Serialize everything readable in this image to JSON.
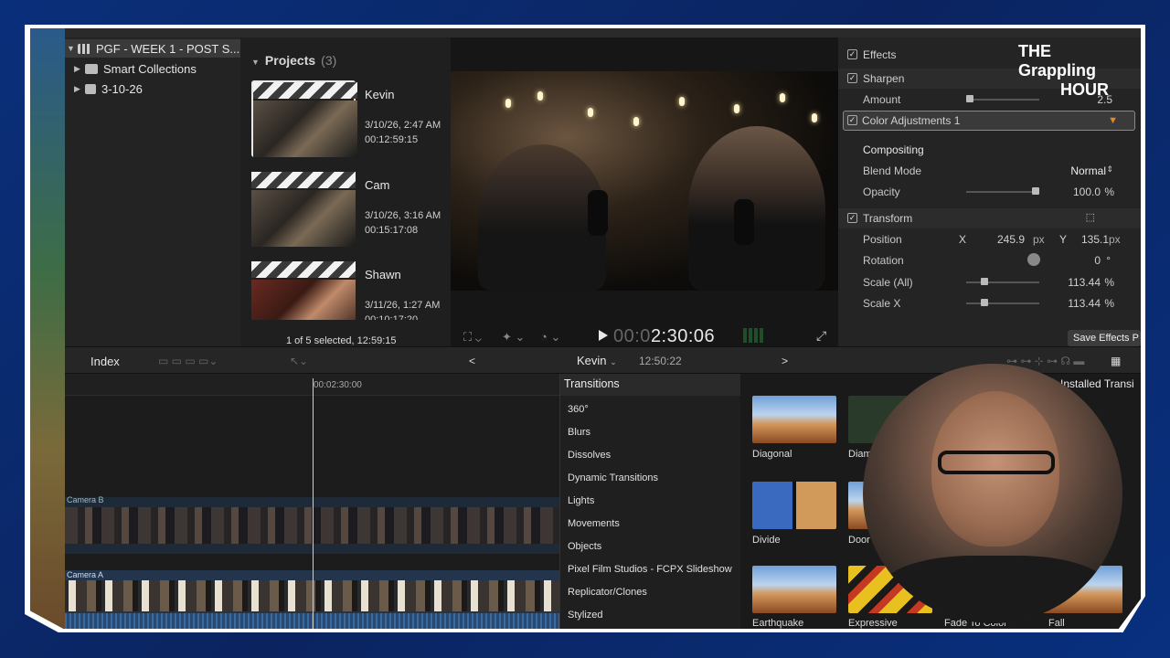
{
  "library": {
    "root": "PGF - WEEK 1 - POST S...",
    "items": [
      "Smart Collections",
      "3-10-26"
    ]
  },
  "browser": {
    "header": "Projects",
    "count": "(3)",
    "clips": [
      {
        "name": "Kevin",
        "date": "3/10/26, 2:47 AM",
        "duration": "00:12:59:15"
      },
      {
        "name": "Cam",
        "date": "3/10/26, 3:16 AM",
        "duration": "00:15:17:08"
      },
      {
        "name": "Shawn",
        "date": "3/11/26, 1:27 AM",
        "duration": "00:10:17:20"
      }
    ],
    "status": "1 of 5 selected, 12:59:15"
  },
  "viewer": {
    "timecode_dim": "00:0",
    "timecode": "2:30:06"
  },
  "inspector": {
    "effects": "Effects",
    "sharpen": "Sharpen",
    "amount_label": "Amount",
    "amount_value": "2.5",
    "color_adj": "Color Adjustments 1",
    "compositing": "Compositing",
    "blend_label": "Blend Mode",
    "blend_value": "Normal",
    "opacity_label": "Opacity",
    "opacity_value": "100.0",
    "opacity_unit": "%",
    "transform": "Transform",
    "position_label": "Position",
    "pos_x_label": "X",
    "pos_x": "245.9",
    "pos_y_label": "Y",
    "pos_y": "135.1",
    "px": "px",
    "rotation_label": "Rotation",
    "rotation_value": "0",
    "deg": "°",
    "scale_all_label": "Scale (All)",
    "scale_all_value": "113.44",
    "scale_x_label": "Scale X",
    "scale_x_value": "113.44",
    "pct": "%",
    "save_effects": "Save Effects P"
  },
  "toolbar": {
    "index": "Index",
    "project": "Kevin",
    "duration": "12:50:22"
  },
  "timeline": {
    "ruler_tc": "00:02:30:00",
    "lane_b": "Camera B",
    "lane_a": "Camera A"
  },
  "transitions": {
    "header": "Transitions",
    "categories": [
      "360°",
      "Blurs",
      "Dissolves",
      "Dynamic Transitions",
      "Lights",
      "Movements",
      "Objects",
      "Pixel Film Studios - FCPX Slideshow",
      "Replicator/Clones",
      "Stylized"
    ],
    "installed": "Installed Transi",
    "tiles": [
      "Diagonal",
      "Diam",
      "Divide",
      "Door",
      "Earthquake",
      "Expressive",
      "Fade To Color",
      "Fall"
    ]
  },
  "logo": {
    "line1": "THE",
    "line2": "Grappling",
    "line3": "HOUR"
  }
}
